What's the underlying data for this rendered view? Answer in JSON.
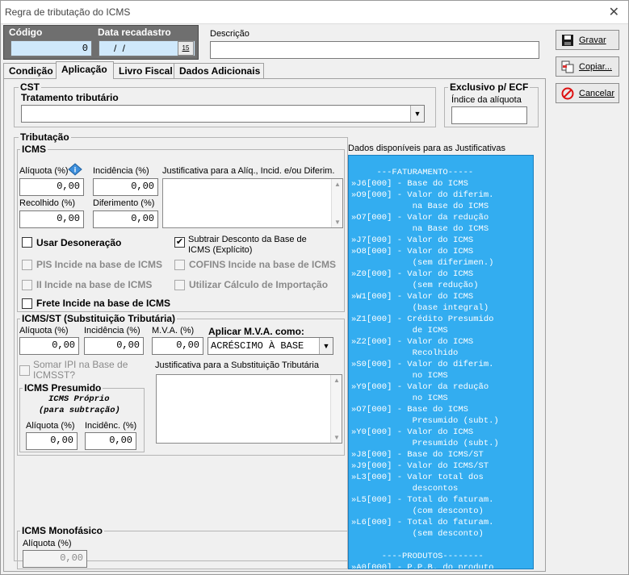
{
  "window": {
    "title": "Regra de tributação do ICMS",
    "close_glyph": "✕"
  },
  "header": {
    "codigo_label": "Código",
    "codigo_value": "0",
    "data_label": "Data recadastro",
    "data_value": "/   /",
    "data_btn": "15",
    "descricao_label": "Descrição",
    "descricao_value": ""
  },
  "buttons": {
    "gravar": "Gravar",
    "copiar": "Copiar...",
    "cancelar": "Cancelar"
  },
  "tabs": [
    "Condição",
    "Aplicação",
    "Livro Fiscal",
    "Dados Adicionais"
  ],
  "cst": {
    "title": "CST",
    "tratamento_label": "Tratamento tributário",
    "tratamento_value": ""
  },
  "ecf": {
    "title": "Exclusivo p/ ECF",
    "indice_label": "Índice da alíquota",
    "indice_value": ""
  },
  "tributacao": {
    "title": "Tributação"
  },
  "icms": {
    "title": "ICMS",
    "aliquota_label": "Alíquota (%)",
    "aliquota_value": "0,00",
    "incidencia_label": "Incidência (%)",
    "incidencia_value": "0,00",
    "recolhido_label": "Recolhido (%)",
    "recolhido_value": "0,00",
    "diferimento_label": "Diferimento (%)",
    "diferimento_value": "0,00",
    "justificativa_label": "Justificativa para a Alíq., Incid. e/ou Diferim.",
    "checks": {
      "usar_desoneracao": {
        "label": "Usar Desoneração",
        "checked": false
      },
      "subtrair_desconto": {
        "label1": "Subtrair Desconto da Base de",
        "label2": "ICMS (Explícito)",
        "checked": true
      },
      "pis": {
        "label": "PIS Incide na base de ICMS",
        "checked": false
      },
      "cofins": {
        "label": "COFINS Incide na base de ICMS",
        "checked": false
      },
      "ii": {
        "label": "II Incide na base de ICMS",
        "checked": false
      },
      "calc_import": {
        "label": "Utilizar Cálculo de Importação",
        "checked": false
      },
      "frete": {
        "label": "Frete Incide na base de ICMS",
        "checked": false
      }
    }
  },
  "icmsst": {
    "title": "ICMS/ST (Substituição Tributária)",
    "aliquota_label": "Alíquota (%)",
    "aliquota_value": "0,00",
    "incidencia_label": "Incidência (%)",
    "incidencia_value": "0,00",
    "mva_label": "M.V.A. (%)",
    "mva_value": "0,00",
    "aplicar_label": "Aplicar M.V.A. como:",
    "aplicar_value": "ACRÉSCIMO À BASE",
    "somar_ipi1": "Somar IPI na Base de",
    "somar_ipi2": "ICMSST?",
    "justificativa_label": "Justificativa para a Substituição Tributária"
  },
  "presumido": {
    "title": "ICMS Presumido",
    "sub1": "ICMS Próprio",
    "sub2": "(para subtração)",
    "aliquota_label": "Alíquota (%)",
    "aliquota_value": "0,00",
    "incidenc_label": "Incidênc. (%)",
    "incidenc_value": "0,00"
  },
  "monofasico": {
    "title": "ICMS Monofásico",
    "aliquota_label": "Alíquota (%)",
    "aliquota_value": "0,00"
  },
  "justificativas": {
    "title": "Dados disponíveis para as Justificativas",
    "lines": [
      "     ---FATURAMENTO-----",
      "»J6[000] - Base do ICMS",
      "»O9[000] - Valor do diferim.",
      "            na Base do ICMS",
      "»O7[000] - Valor da redução",
      "            na Base do ICMS",
      "»J7[000] - Valor do ICMS",
      "»O8[000] - Valor do ICMS",
      "            (sem diferimen.)",
      "»Z0[000] - Valor do ICMS",
      "            (sem redução)",
      "»W1[000] - Valor do ICMS",
      "            (base integral)",
      "»Z1[000] - Crédito Presumido",
      "            de ICMS",
      "»Z2[000] - Valor do ICMS",
      "            Recolhido",
      "»S0[000] - Valor do diferim.",
      "            no ICMS",
      "»Y9[000] - Valor da redução",
      "            no ICMS",
      "»O7[000] - Base do ICMS",
      "            Presumido (subt.)",
      "»Y0[000] - Valor do ICMS",
      "            Presumido (subt.)",
      "»J8[000] - Base do ICMS/ST",
      "»J9[000] - Valor do ICMS/ST",
      "»L3[000] - Valor total dos",
      "            descontos",
      "»L5[000] - Total do faturam.",
      "            (com desconto)",
      "»L6[000] - Total do faturam.",
      "            (sem desconto)",
      "",
      "      ----PRODUTOS--------",
      "»A0[000] - P.P.B. do produto"
    ]
  },
  "colors": {
    "justif_bg": "#33adf0",
    "header_bg": "#6f6f6f",
    "field_blue": "#cfe8fb"
  }
}
